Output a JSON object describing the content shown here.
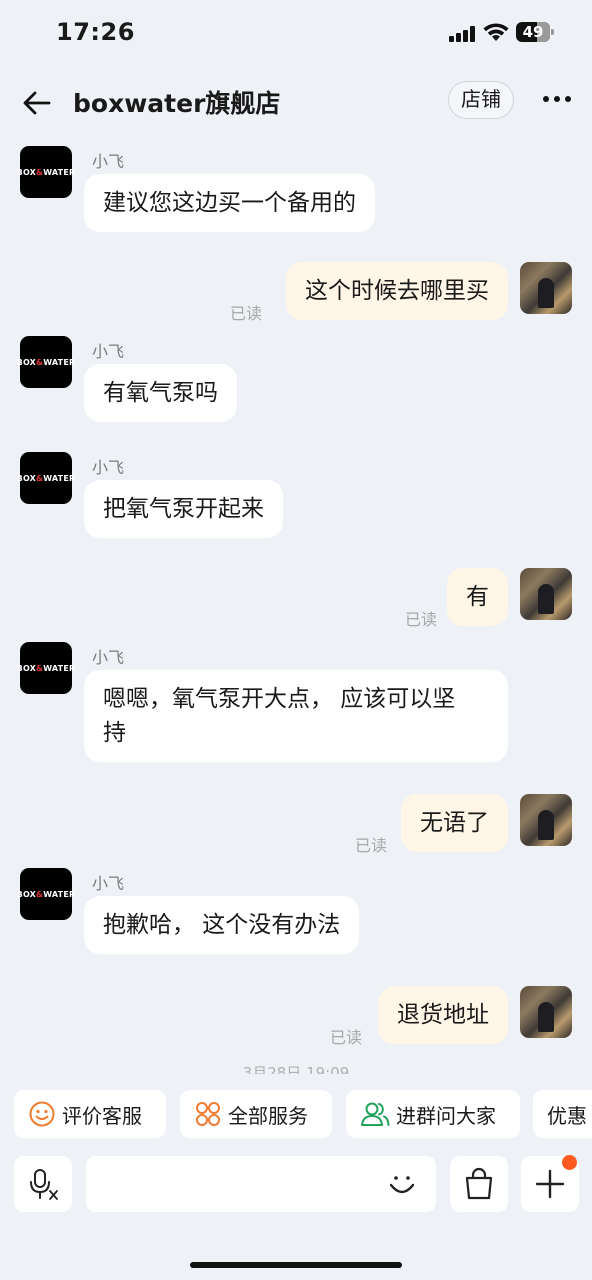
{
  "status_bar": {
    "time": "17:26",
    "battery": "49"
  },
  "header": {
    "title": "boxwater旗舰店",
    "store_button": "店铺"
  },
  "shop_avatar": {
    "part1": "BOX",
    "part2": "&",
    "part3": "WATER"
  },
  "messages": [
    {
      "side": "left",
      "sender": "小飞",
      "text": "建议您这边买一个备用的"
    },
    {
      "side": "right",
      "read": "已读",
      "text": "这个时候去哪里买"
    },
    {
      "side": "left",
      "sender": "小飞",
      "text": "有氧气泵吗"
    },
    {
      "side": "left",
      "sender": "小飞",
      "text": "把氧气泵开起来"
    },
    {
      "side": "right",
      "read": "已读",
      "text": "有"
    },
    {
      "side": "left",
      "sender": "小飞",
      "text": "嗯嗯，氧气泵开大点， 应该可以坚\n持"
    },
    {
      "side": "right",
      "read": "已读",
      "text": "无语了"
    },
    {
      "side": "left",
      "sender": "小飞",
      "text": "抱歉哈， 这个没有办法"
    },
    {
      "side": "right",
      "read": "已读",
      "text": "退货地址"
    }
  ],
  "timestamp": "3月28日 19:09",
  "quick_actions": [
    {
      "label": "评价客服",
      "icon": "smile-icon",
      "color": "#f07b2f"
    },
    {
      "label": "全部服务",
      "icon": "grid-icon",
      "color": "#f07b2f"
    },
    {
      "label": "进群问大家",
      "icon": "group-icon",
      "color": "#22a35a"
    },
    {
      "label": "优惠",
      "icon": "",
      "color": ""
    }
  ],
  "input": {
    "placeholder": ""
  },
  "colors": {
    "accent": "#ff5a1f",
    "right_bubble": "#fff6e7",
    "background": "#eef1f6"
  }
}
